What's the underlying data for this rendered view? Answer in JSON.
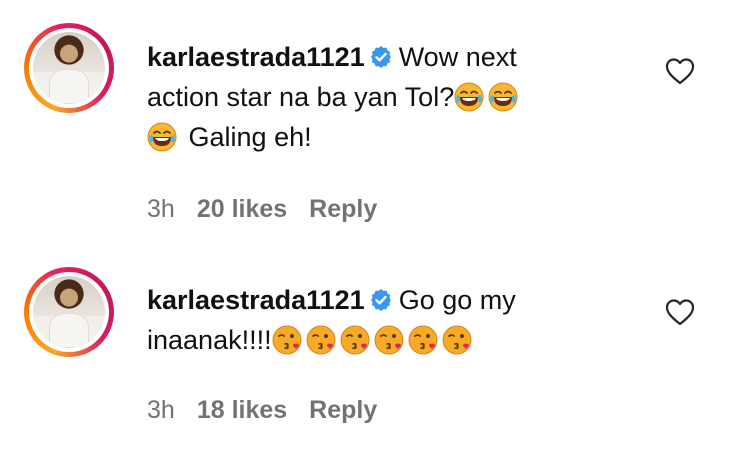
{
  "comments": [
    {
      "username": "karlaestrada1121",
      "text_line1": "Wow next",
      "text_line2": "action star na ba yan Tol?",
      "text_line3": "Galing eh!",
      "emoji_after_line2": [
        "laughing-tears",
        "laughing-tears"
      ],
      "emoji_before_line3": [
        "laughing-tears"
      ],
      "time": "3h",
      "likes": "20 likes",
      "reply": "Reply"
    },
    {
      "username": "karlaestrada1121",
      "text_line1": "Go go my",
      "text_line2": "inaanak!!!!",
      "emoji_after_line2": [
        "kissing-heart",
        "kissing-heart",
        "kissing-heart",
        "kissing-heart",
        "kissing-heart",
        "kissing-heart"
      ],
      "time": "3h",
      "likes": "18 likes",
      "reply": "Reply"
    }
  ],
  "colors": {
    "verified": "#3897f0",
    "meta_text": "#737373",
    "story_ring_start": "#f9a825",
    "story_ring_end": "#c2185b"
  },
  "icons": {
    "verified": "verified-badge-icon",
    "like": "heart-outline-icon"
  }
}
